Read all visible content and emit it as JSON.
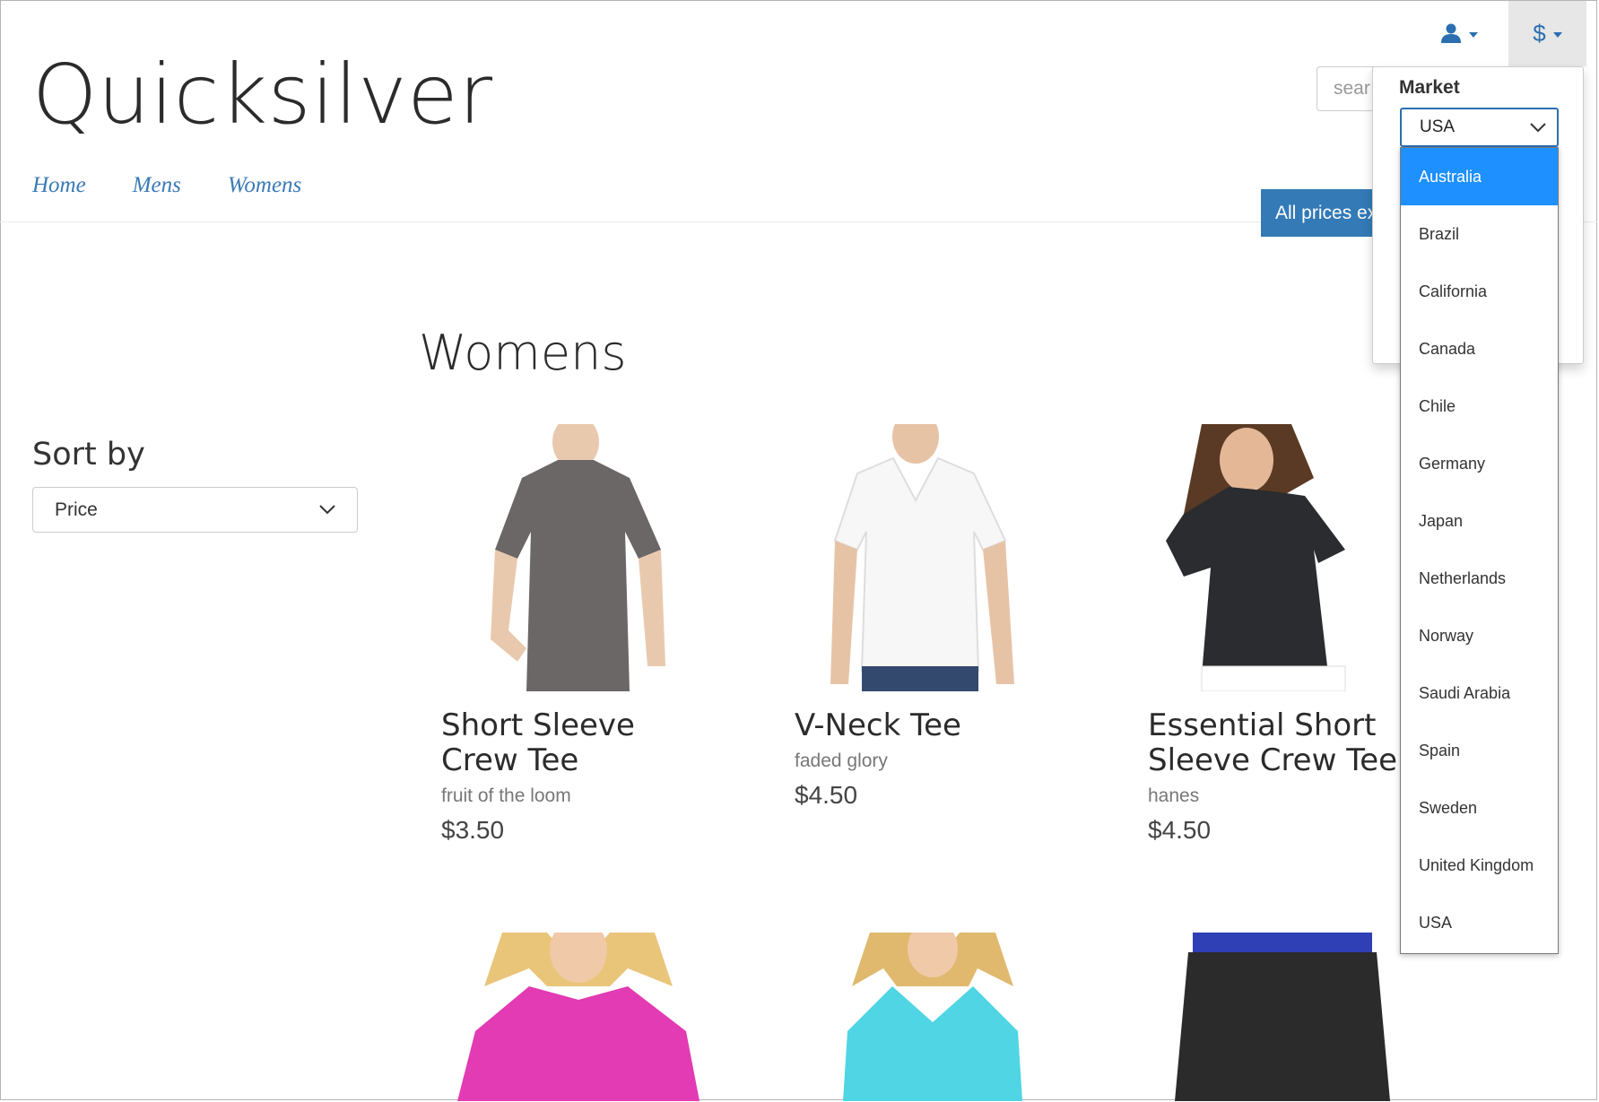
{
  "header": {
    "brand": "Quicksilver",
    "currency_symbol": "$",
    "search_placeholder": "sear",
    "prices_banner": "All prices ex"
  },
  "nav": {
    "items": [
      "Home",
      "Mens",
      "Womens"
    ]
  },
  "page": {
    "title": "Womens"
  },
  "sort": {
    "label": "Sort by",
    "value": "Price"
  },
  "products": [
    {
      "name_line1": "Short Sleeve",
      "name_line2": "Crew Tee",
      "brand": "fruit of the loom",
      "price": "$3.50",
      "color": "#6b6767"
    },
    {
      "name_line1": "V-Neck Tee",
      "name_line2": "",
      "brand": "faded glory",
      "price": "$4.50",
      "color": "#fafafa"
    },
    {
      "name_line1": "Essential Short",
      "name_line2": "Sleeve Crew Tee",
      "brand": "hanes",
      "price": "$4.50",
      "color": "#2a2c2f"
    },
    {
      "color": "#e23bb3"
    },
    {
      "color": "#4fd5e4"
    },
    {
      "color": "#2b2b2b"
    }
  ],
  "market": {
    "label": "Market",
    "selected": "USA",
    "options": [
      "Australia",
      "Brazil",
      "California",
      "Canada",
      "Chile",
      "Germany",
      "Japan",
      "Netherlands",
      "Norway",
      "Saudi Arabia",
      "Spain",
      "Sweden",
      "United Kingdom",
      "USA"
    ],
    "highlighted": "Australia"
  },
  "colors": {
    "accent": "#337ab7",
    "highlight": "#1e90ff",
    "link": "#3a7ab7"
  },
  "icons": {
    "user": "user-icon",
    "caret": "caret-down-icon",
    "chevron": "chevron-down-icon"
  }
}
